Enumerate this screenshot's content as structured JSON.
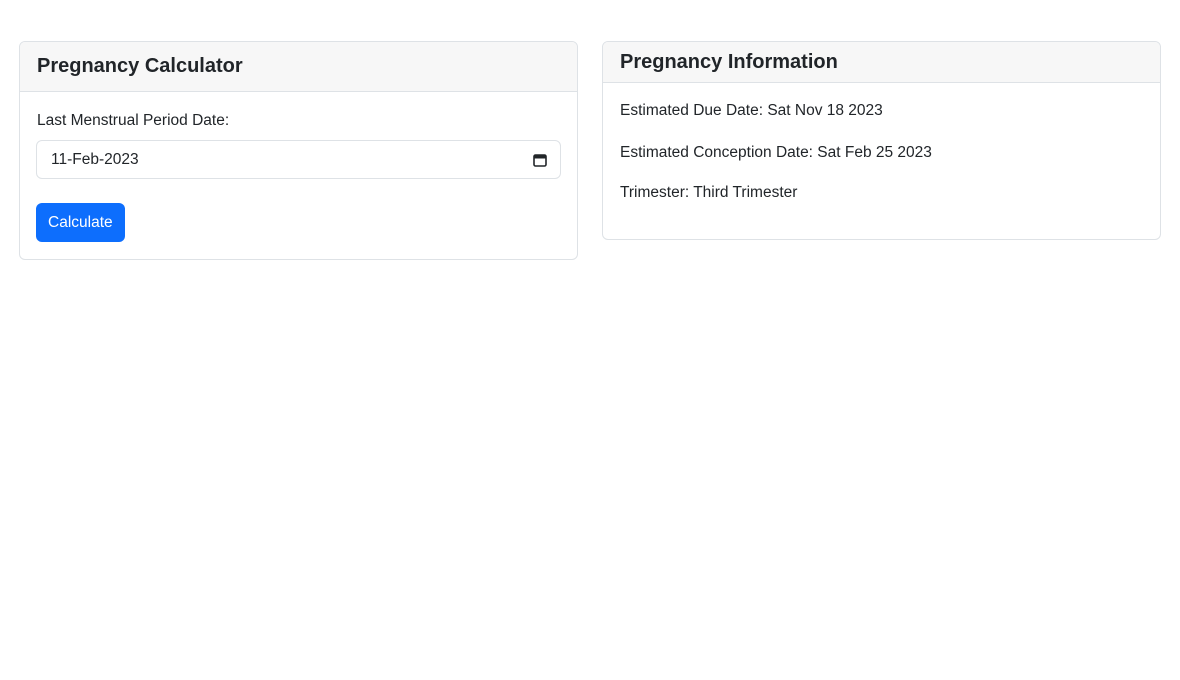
{
  "calculator": {
    "title": "Pregnancy Calculator",
    "lmp_label": "Last Menstrual Period Date:",
    "lmp_value": "11-Feb-2023",
    "calculate_label": "Calculate"
  },
  "information": {
    "title": "Pregnancy Information",
    "due_date_text": "Estimated Due Date: Sat Nov 18 2023",
    "conception_date_text": "Estimated Conception Date: Sat Feb 25 2023",
    "trimester_text": "Trimester: Third Trimester"
  },
  "icons": {
    "date_picker": "calendar-icon"
  },
  "colors": {
    "primary": "#0d6efd",
    "header_bg": "#f7f7f7",
    "border": "#dee2e6",
    "text": "#212529"
  }
}
